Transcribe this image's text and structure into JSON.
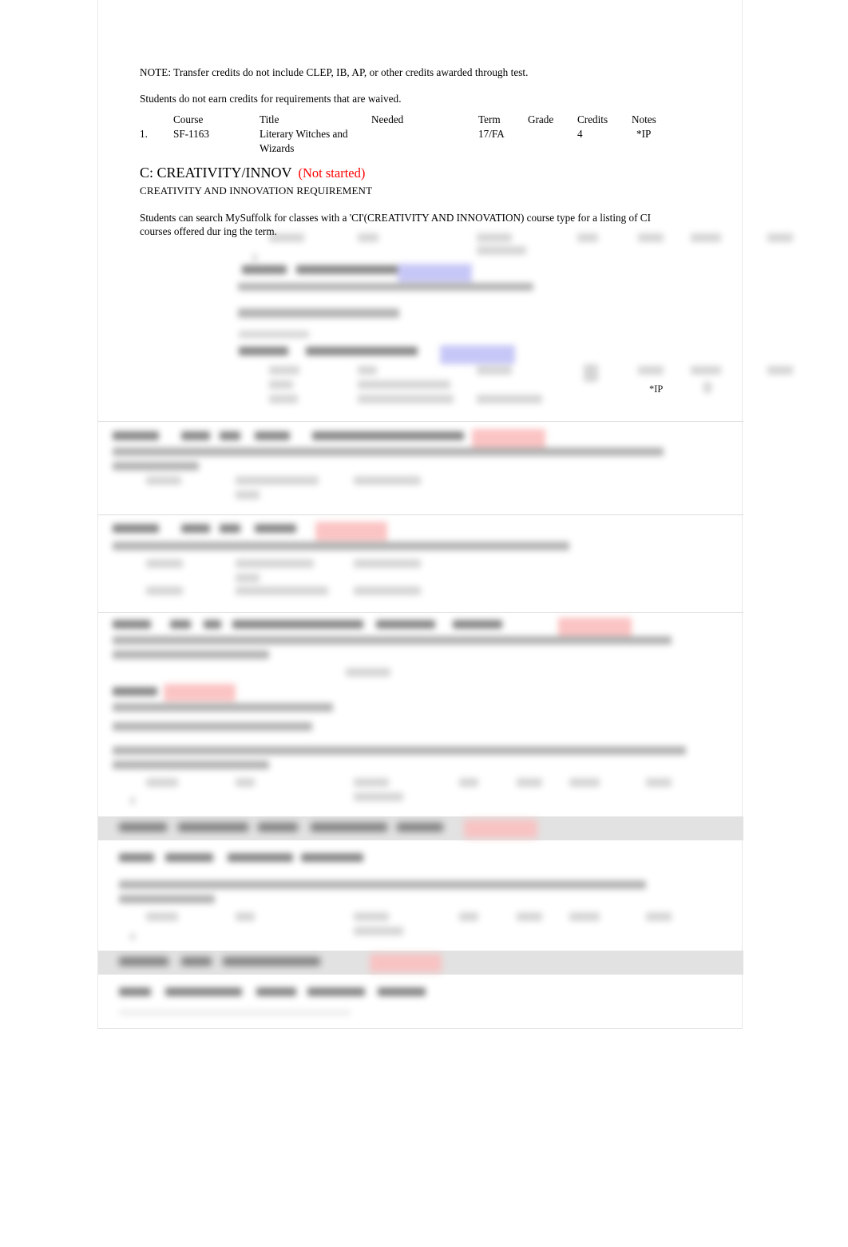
{
  "document": {
    "type": "degree-audit",
    "notes": [
      "NOTE: Transfer credits do not include CLEP, IB, AP, or other credits awarded through test.",
      "Students do not earn credits for requirements that are waived."
    ],
    "course_table": {
      "headers": {
        "num": "",
        "course": "Course",
        "title": "Title",
        "needed": "Needed",
        "term": "Term",
        "grade": "Grade",
        "credits": "Credits",
        "notes": "Notes"
      },
      "rows": [
        {
          "num": "1.",
          "course": "SF-1163",
          "title": "Literary Witches and Wizards",
          "needed": "",
          "term": "17/FA",
          "grade": "",
          "credits": "4",
          "notes": "*IP"
        }
      ]
    },
    "section": {
      "code_title": "C: CREATIVITY/INNOV",
      "status": "(Not started)",
      "status_color": "#ff0000",
      "subtitle": "CREATIVITY AND INNOVATION REQUIREMENT",
      "description": "Students can search MySuffolk for classes with a 'CI'(CREATIVITY AND INNOVATION) course type for a listing of CI courses offered dur ing the term.",
      "inline_notes": [
        "*IP"
      ]
    },
    "redacted_regions": {
      "label": "Blurred / illegible audit sections",
      "count": 9,
      "highlight_colors": {
        "blue": "#c3c3f7",
        "red": "#fbbfbf",
        "section_band": "#e2e2e2"
      }
    }
  }
}
